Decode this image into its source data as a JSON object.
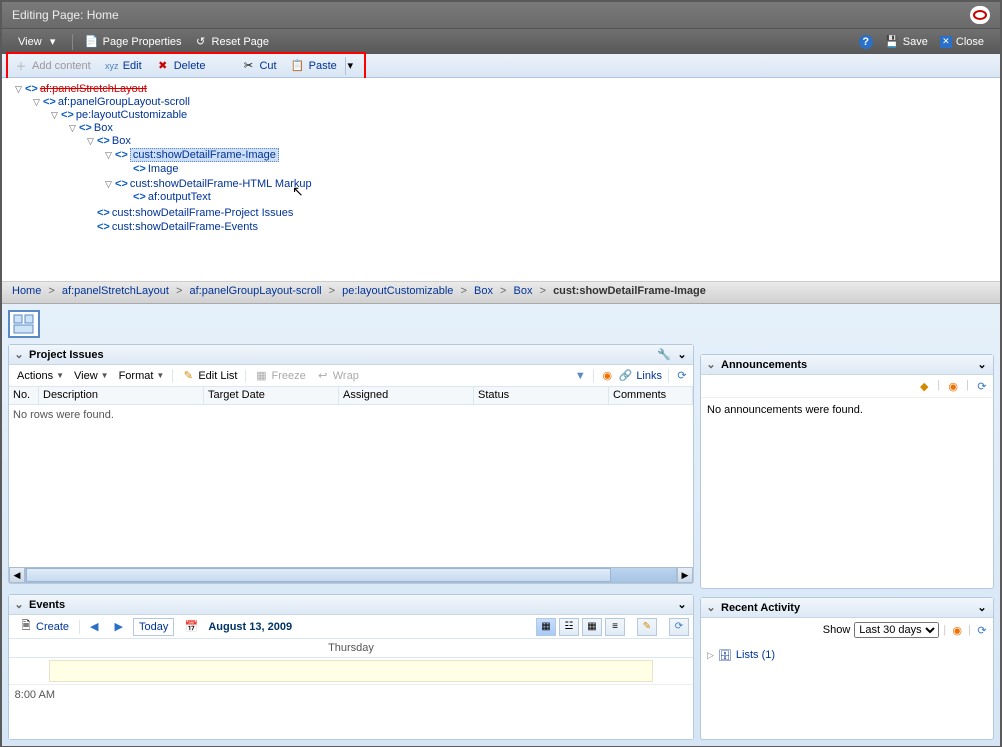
{
  "header": {
    "title": "Editing Page: Home",
    "view": "View",
    "page_properties": "Page Properties",
    "reset_page": "Reset Page",
    "save": "Save",
    "close": "Close"
  },
  "toolbar": {
    "add_content": "Add content",
    "edit": "Edit",
    "delete": "Delete",
    "cut": "Cut",
    "paste": "Paste"
  },
  "tree": {
    "root": "af:panelStretchLayout",
    "n1": "af:panelGroupLayout-scroll",
    "n2": "pe:layoutCustomizable",
    "n3": "Box",
    "n4": "Box",
    "n5": "cust:showDetailFrame-Image",
    "n6": "Image",
    "n7": "cust:showDetailFrame-HTML Markup",
    "n8": "af:outputText",
    "n9": "cust:showDetailFrame-Project Issues",
    "n10": "cust:showDetailFrame-Events"
  },
  "breadcrumb": {
    "home": "Home",
    "c1": "af:panelStretchLayout",
    "c2": "af:panelGroupLayout-scroll",
    "c3": "pe:layoutCustomizable",
    "c4": "Box",
    "c5": "Box",
    "last": "cust:showDetailFrame-Image"
  },
  "issues": {
    "title": "Project Issues",
    "actions": "Actions",
    "view": "View",
    "format": "Format",
    "edit_list": "Edit List",
    "freeze": "Freeze",
    "wrap": "Wrap",
    "links": "Links",
    "columns": {
      "no": "No.",
      "description": "Description",
      "target_date": "Target Date",
      "assigned": "Assigned",
      "status": "Status",
      "comments": "Comments"
    },
    "empty": "No rows were found."
  },
  "events": {
    "title": "Events",
    "create": "Create",
    "today": "Today",
    "date": "August 13, 2009",
    "day_label": "Thursday",
    "time_8am": "8:00 AM"
  },
  "announcements": {
    "title": "Announcements",
    "empty": "No announcements were found."
  },
  "recent": {
    "title": "Recent Activity",
    "show": "Show",
    "range": "Last 30 days",
    "lists_label": "Lists (1)"
  }
}
